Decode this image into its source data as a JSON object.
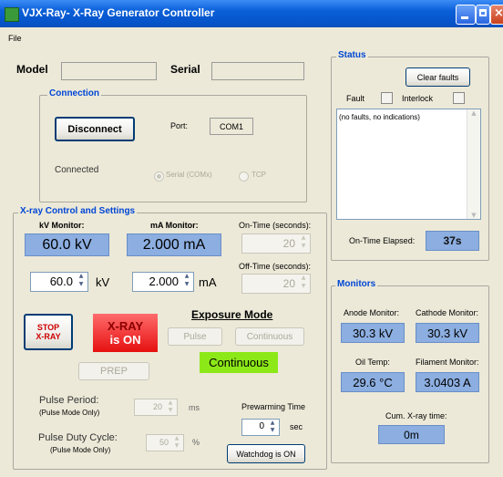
{
  "window": {
    "title": "VJX-Ray-  X-Ray Generator Controller"
  },
  "menu": {
    "file": "File"
  },
  "identity": {
    "model_label": "Model",
    "model_value": "",
    "serial_label": "Serial",
    "serial_value": ""
  },
  "connection": {
    "title": "Connection",
    "disconnect_label": "Disconnect",
    "port_label": "Port:",
    "port_value": "COM1",
    "status_text": "Connected",
    "serial_option": "Serial (COMx)",
    "tcp_option": "TCP",
    "selected": "Serial (COMx)"
  },
  "xray": {
    "title": "X-ray Control and Settings",
    "kv_monitor_label": "kV Monitor:",
    "kv_monitor_value": "60.0 kV",
    "ma_monitor_label": "mA Monitor:",
    "ma_monitor_value": "2.000 mA",
    "kv_set_value": "60.0",
    "kv_unit": "kV",
    "ma_set_value": "2.000",
    "ma_unit": "mA",
    "on_time_label": "On-Time (seconds):",
    "on_time_value": "20",
    "off_time_label": "Off-Time (seconds):",
    "off_time_value": "20",
    "stop_label_1": "STOP",
    "stop_label_2": "X-RAY",
    "status_1": "X-RAY",
    "status_2": "is ON",
    "exposure_mode_label": "Exposure Mode",
    "pulse_label": "Pulse",
    "continuous_label": "Continuous",
    "current_mode": "Continuous",
    "prep_label": "PREP",
    "pulse_period_label": "Pulse Period:",
    "pulse_period_note": "(Pulse Mode Only)",
    "pulse_period_value": "20",
    "pulse_period_unit": "ms",
    "duty_cycle_label": "Pulse Duty Cycle:",
    "duty_cycle_note": "(Pulse Mode Only)",
    "duty_cycle_value": "50",
    "duty_cycle_unit": "%",
    "prewarming_label": "Prewarming Time",
    "prewarming_value": "0",
    "prewarming_unit": "sec",
    "watchdog_label": "Watchdog is ON"
  },
  "status": {
    "title": "Status",
    "clear_faults_label": "Clear faults",
    "fault_label": "Fault",
    "interlock_label": "Interlock",
    "log_text": "(no faults, no indications)",
    "on_time_elapsed_label": "On-Time Elapsed:",
    "on_time_elapsed_value": "37s"
  },
  "monitors": {
    "title": "Monitors",
    "anode_label": "Anode Monitor:",
    "anode_value": "30.3 kV",
    "cathode_label": "Cathode Monitor:",
    "cathode_value": "30.3 kV",
    "oil_label": "Oil Temp:",
    "oil_value": "29.6 °C",
    "filament_label": "Filament Monitor:",
    "filament_value": "3.0403 A",
    "cum_label": "Cum. X-ray time:",
    "cum_value": "0m"
  }
}
